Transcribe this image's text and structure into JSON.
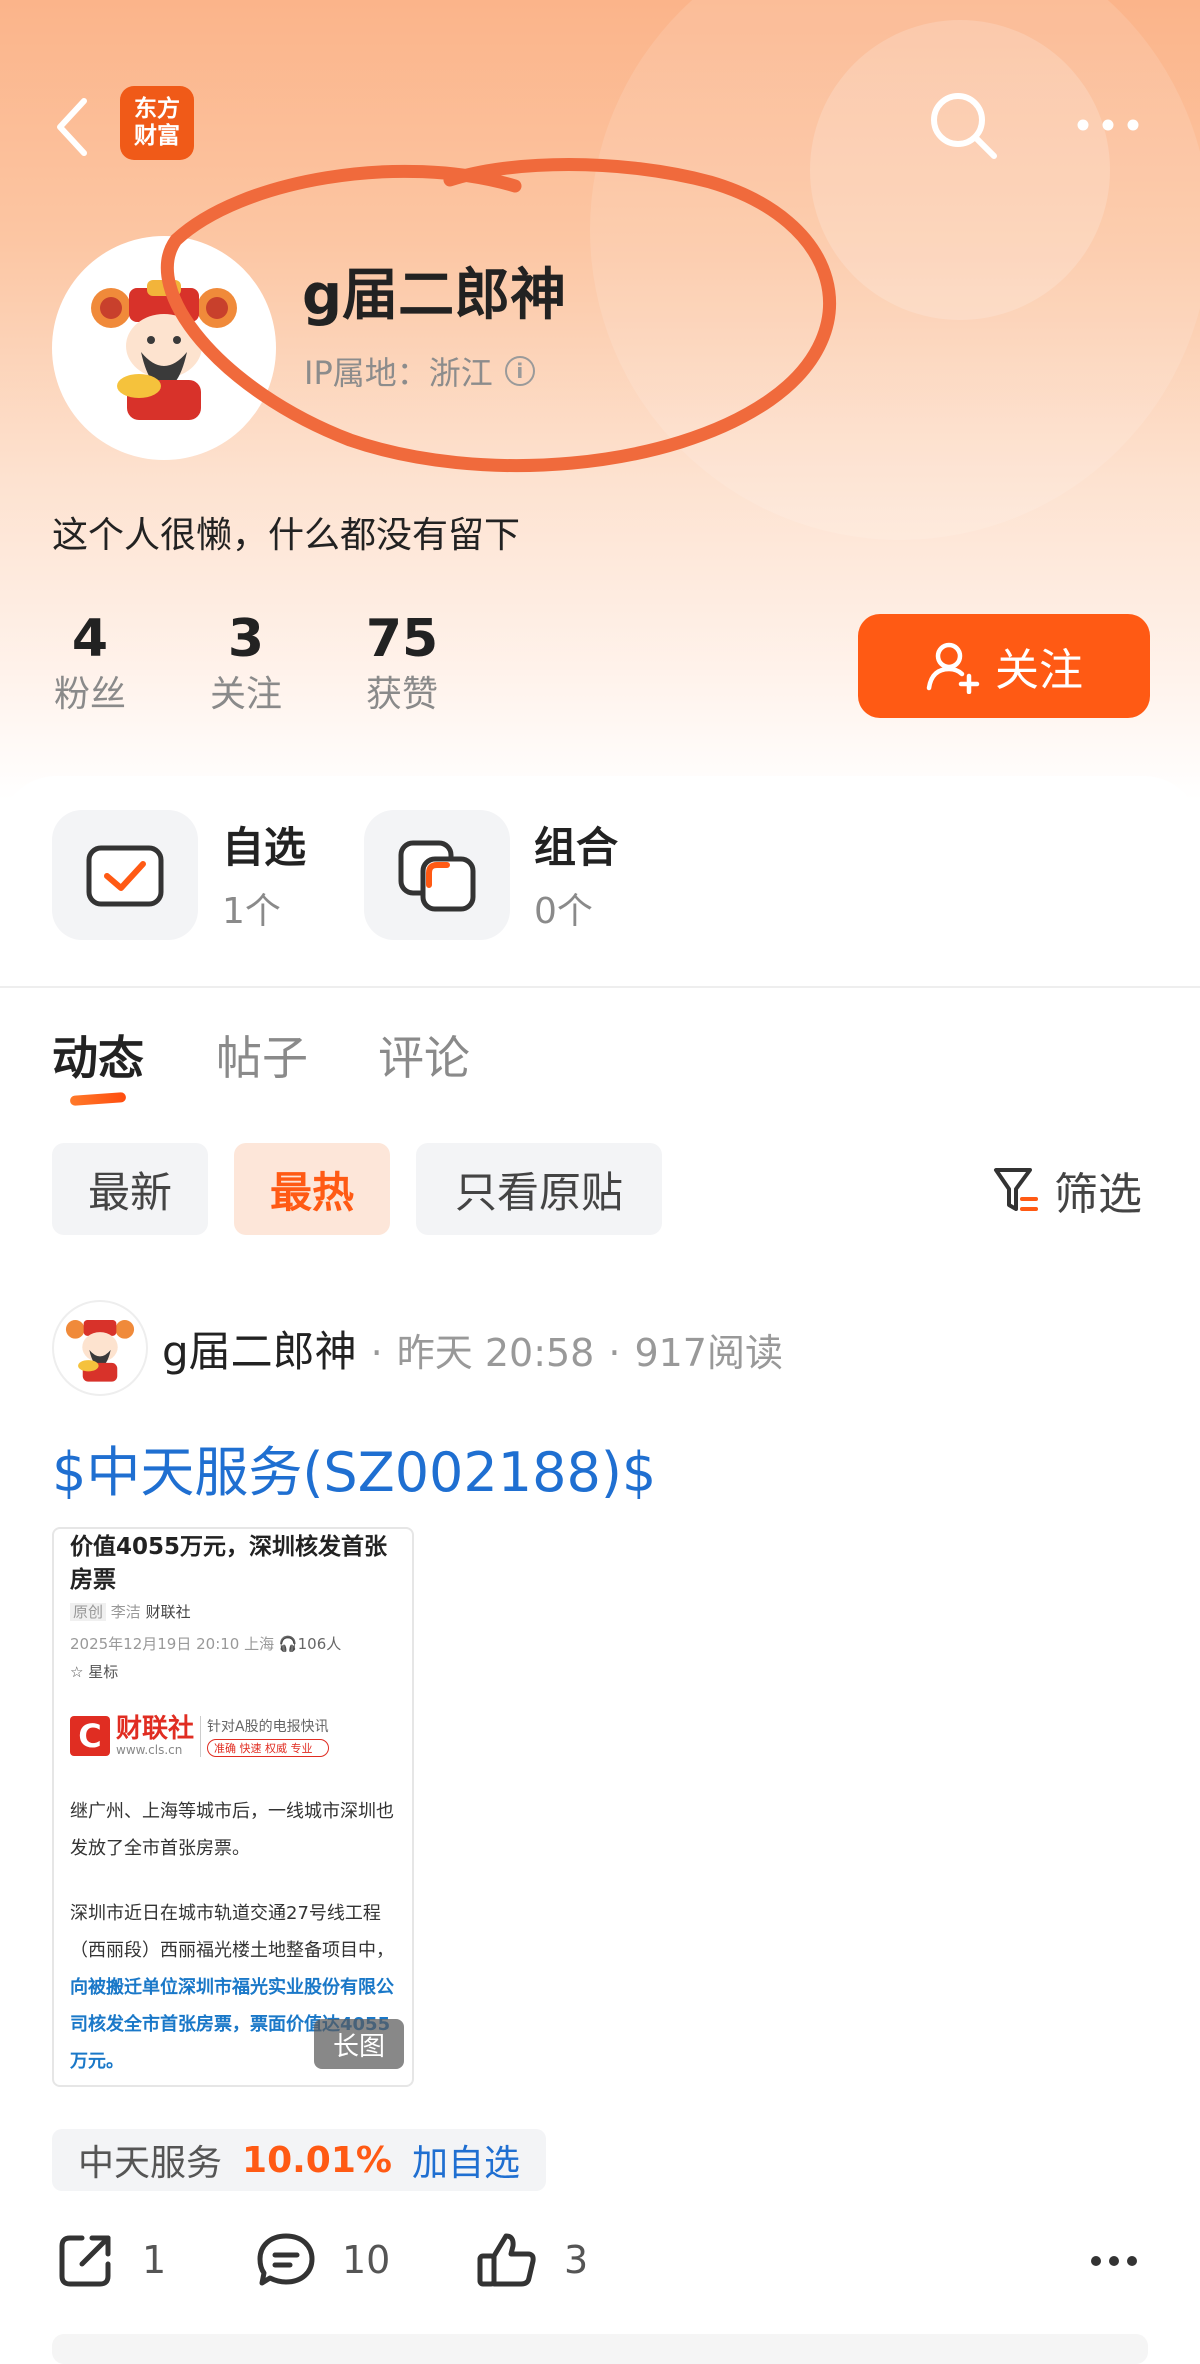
{
  "app": {
    "logo_line1": "东方",
    "logo_line2": "财富"
  },
  "profile": {
    "username": "g届二郎神",
    "ip_location": "IP属地：浙江",
    "bio": "这个人很懒，什么都没有留下"
  },
  "stats": [
    {
      "value": "4",
      "label": "粉丝"
    },
    {
      "value": "3",
      "label": "关注"
    },
    {
      "value": "75",
      "label": "获赞"
    }
  ],
  "follow_button": {
    "label": "关注"
  },
  "quick_entries": [
    {
      "title": "自选",
      "sub": "1个"
    },
    {
      "title": "组合",
      "sub": "0个"
    }
  ],
  "tabs": [
    {
      "label": "动态"
    },
    {
      "label": "帖子"
    },
    {
      "label": "评论"
    }
  ],
  "filters": {
    "chips": [
      "最新",
      "最热",
      "只看原贴"
    ],
    "filter_label": "筛选"
  },
  "post": {
    "author": "g届二郎神",
    "time": "昨天 20:58",
    "reads": "917阅读",
    "title": "$中天服务(SZ002188)$",
    "image": {
      "headline": "价值4055万元，深圳核发首张房票",
      "tag": "原创",
      "author": "李洁",
      "source": "财联社",
      "datetime": "2025年12月19日 20:10",
      "place": "上海",
      "listeners": "106人",
      "star": "☆ 星标",
      "brand_name": "财联社",
      "brand_url": "www.cls.cn",
      "brand_slogan": "针对A股的电报快讯",
      "brand_tags": "准确 快速 权威 专业",
      "para1": "继广州、上海等城市后，一线城市深圳也发放了全市首张房票。",
      "para2_plain": "深圳市近日在城市轨道交通27号线工程（西丽段）西丽福光楼土地整备项目中，",
      "para2_bold": "向被搬迁单位深圳市福光实业股份有限公司核发全市首张房票，票面价值达4055万元。",
      "long_badge": "长图"
    },
    "stock": {
      "name": "中天服务",
      "change": "10.01%",
      "add_label": "加自选"
    },
    "actions": {
      "share": "1",
      "comments": "10",
      "likes": "3"
    }
  },
  "colors": {
    "accent": "#ff5a14",
    "link": "#1f6fd1",
    "annotation": "#f06a3c"
  },
  "icons": [
    "back-icon",
    "search-icon",
    "more-icon",
    "info-icon",
    "add-user-icon",
    "watchlist-icon",
    "portfolio-icon",
    "filter-icon",
    "share-icon",
    "comment-icon",
    "like-icon",
    "headphone-icon"
  ]
}
